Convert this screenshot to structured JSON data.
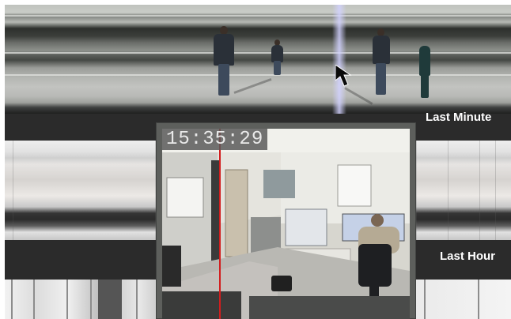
{
  "timeline": {
    "minute_label": "Last Minute",
    "hour_label": "Last Hour"
  },
  "video": {
    "timestamp": "15:35:29"
  },
  "icons": {
    "cursor": "arrow-pointer-icon"
  },
  "colors": {
    "band": "#2b2b2b",
    "label_text": "#ffffff",
    "popup_frame": "#5d5f5c",
    "scrub_line": "#d21e1e",
    "timestamp_text": "#e9e9e9"
  }
}
